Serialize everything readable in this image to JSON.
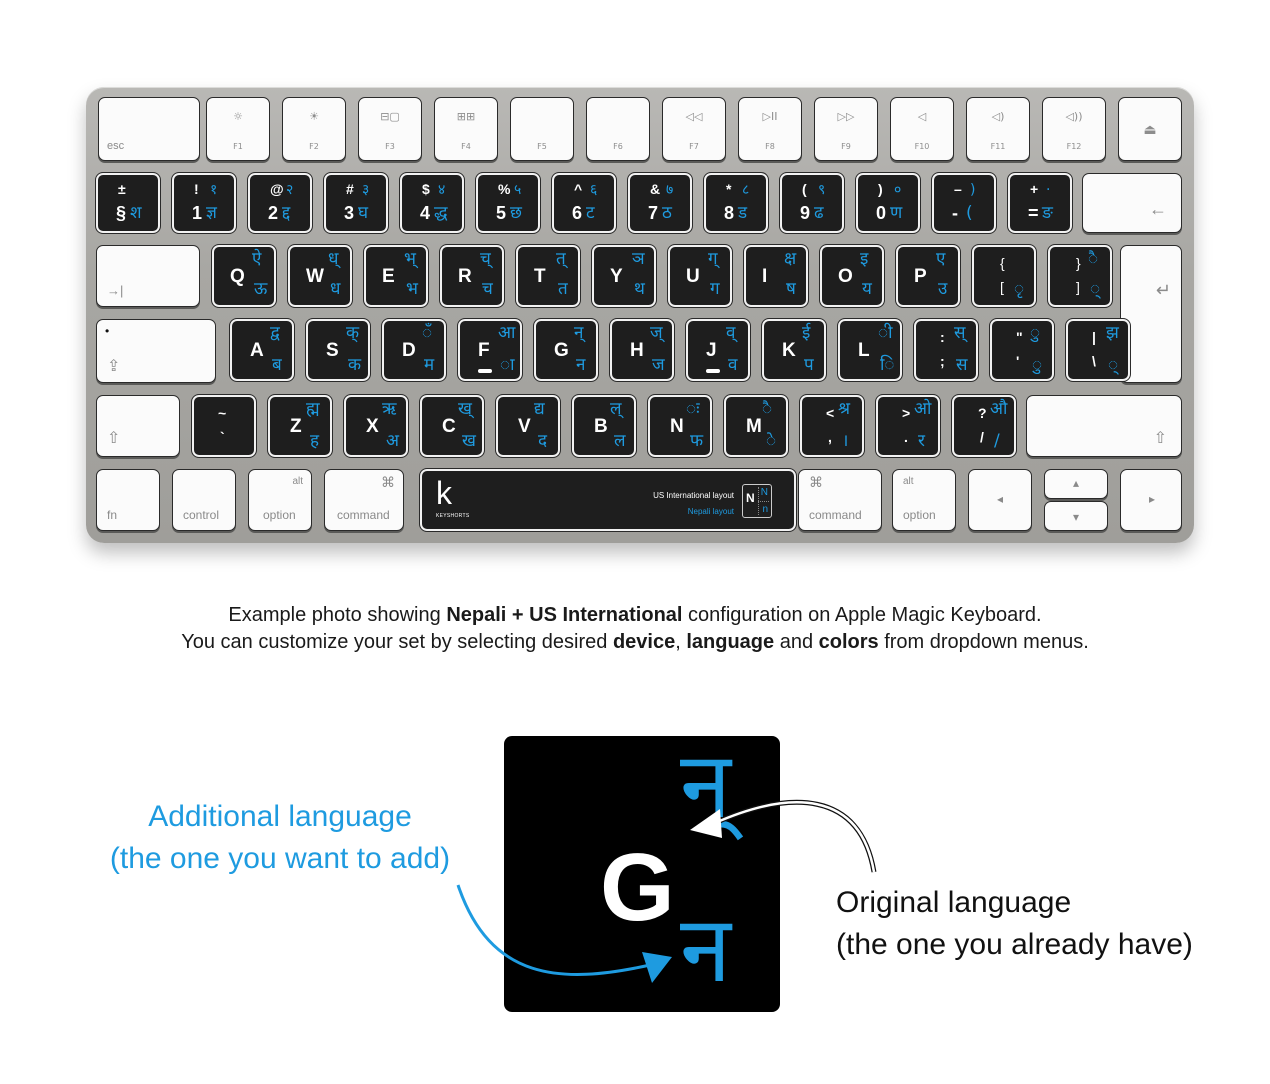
{
  "keyboard": {
    "model": "Apple Magic Keyboard",
    "accent_color": "#1e9be0",
    "sticker_color": "#1e1e1e",
    "function_row": [
      {
        "label": "esc",
        "icon": ""
      },
      {
        "label": "F1",
        "icon": "brightness-down-icon",
        "glyph": "☼"
      },
      {
        "label": "F2",
        "icon": "brightness-up-icon",
        "glyph": "☀"
      },
      {
        "label": "F3",
        "icon": "mission-control-icon",
        "glyph": "⊟▢"
      },
      {
        "label": "F4",
        "icon": "launchpad-icon",
        "glyph": "⊞⊞"
      },
      {
        "label": "F5",
        "icon": ""
      },
      {
        "label": "F6",
        "icon": ""
      },
      {
        "label": "F7",
        "icon": "rewind-icon",
        "glyph": "◁◁"
      },
      {
        "label": "F8",
        "icon": "play-pause-icon",
        "glyph": "▷II"
      },
      {
        "label": "F9",
        "icon": "fast-forward-icon",
        "glyph": "▷▷"
      },
      {
        "label": "F10",
        "icon": "mute-icon",
        "glyph": "◁"
      },
      {
        "label": "F11",
        "icon": "volume-down-icon",
        "glyph": "◁)"
      },
      {
        "label": "F12",
        "icon": "volume-up-icon",
        "glyph": "◁))"
      },
      {
        "label": "",
        "icon": "eject-icon",
        "glyph": "⏏"
      }
    ],
    "number_row": [
      {
        "shift": "±",
        "base": "§",
        "dev_shift": "",
        "dev_base": "श"
      },
      {
        "shift": "!",
        "base": "1",
        "dev_shift": "१",
        "dev_base": "ज्ञ"
      },
      {
        "shift": "@",
        "base": "2",
        "dev_shift": "२",
        "dev_base": "द्द"
      },
      {
        "shift": "#",
        "base": "3",
        "dev_shift": "३",
        "dev_base": "घ"
      },
      {
        "shift": "$",
        "base": "4",
        "dev_shift": "४",
        "dev_base": "द्ध"
      },
      {
        "shift": "%",
        "base": "5",
        "dev_shift": "५",
        "dev_base": "छ"
      },
      {
        "shift": "^",
        "base": "6",
        "dev_shift": "६",
        "dev_base": "ट"
      },
      {
        "shift": "&",
        "base": "7",
        "dev_shift": "७",
        "dev_base": "ठ"
      },
      {
        "shift": "*",
        "base": "8",
        "dev_shift": "८",
        "dev_base": "ड"
      },
      {
        "shift": "(",
        "base": "9",
        "dev_shift": "९",
        "dev_base": "ढ"
      },
      {
        "shift": ")",
        "base": "0",
        "dev_shift": "०",
        "dev_base": "ण"
      },
      {
        "shift": "–",
        "base": "-",
        "dev_shift": ")",
        "dev_base": "("
      },
      {
        "shift": "+",
        "base": "=",
        "dev_shift": "·",
        "dev_base": "ङ"
      }
    ],
    "backspace_glyph": "←",
    "tab_glyph": "→|",
    "qwerty_row": [
      {
        "latin": "Q",
        "dev_shift": "ऐ",
        "dev_base": "ऊ"
      },
      {
        "latin": "W",
        "dev_shift": "ध्",
        "dev_base": "ध"
      },
      {
        "latin": "E",
        "dev_shift": "भ्",
        "dev_base": "भ"
      },
      {
        "latin": "R",
        "dev_shift": "च्",
        "dev_base": "च"
      },
      {
        "latin": "T",
        "dev_shift": "त्",
        "dev_base": "त"
      },
      {
        "latin": "Y",
        "dev_shift": "ञ",
        "dev_base": "थ"
      },
      {
        "latin": "U",
        "dev_shift": "ग्",
        "dev_base": "ग"
      },
      {
        "latin": "I",
        "dev_shift": "क्ष",
        "dev_base": "ष"
      },
      {
        "latin": "O",
        "dev_shift": "इ",
        "dev_base": "य"
      },
      {
        "latin": "P",
        "dev_shift": "ए",
        "dev_base": "उ"
      },
      {
        "latin": "{ [",
        "dev_shift": "",
        "dev_base": "ृ"
      },
      {
        "latin": "} ]",
        "dev_shift": "ै",
        "dev_base": "्"
      }
    ],
    "return_glyph": "↵",
    "home_row": [
      {
        "latin": "A",
        "dev_shift": "द्व",
        "dev_base": "ब"
      },
      {
        "latin": "S",
        "dev_shift": "क्",
        "dev_base": "क"
      },
      {
        "latin": "D",
        "dev_shift": "ँ",
        "dev_base": "म"
      },
      {
        "latin": "F",
        "dev_shift": "आ",
        "dev_base": "ा"
      },
      {
        "latin": "G",
        "dev_shift": "न्",
        "dev_base": "न"
      },
      {
        "latin": "H",
        "dev_shift": "ज्",
        "dev_base": "ज"
      },
      {
        "latin": "J",
        "dev_shift": "व्",
        "dev_base": "व"
      },
      {
        "latin": "K",
        "dev_shift": "ई",
        "dev_base": "प"
      },
      {
        "latin": "L",
        "dev_shift": "ी",
        "dev_base": "ि"
      },
      {
        "latin": ": ;",
        "dev_shift": "स्",
        "dev_base": "स"
      },
      {
        "latin": "\" '",
        "dev_shift": "ु",
        "dev_base": "ु"
      },
      {
        "latin": "| \\",
        "dev_shift": "झ",
        "dev_base": "्"
      }
    ],
    "caps_glyph": "⇪",
    "shift_glyph": "⇧",
    "bottom_row": [
      {
        "latin": "~ `",
        "dev_shift": "",
        "dev_base": ""
      },
      {
        "latin": "Z",
        "dev_shift": "ह्म",
        "dev_base": "ह"
      },
      {
        "latin": "X",
        "dev_shift": "ऋ",
        "dev_base": "अ"
      },
      {
        "latin": "C",
        "dev_shift": "ख्",
        "dev_base": "ख"
      },
      {
        "latin": "V",
        "dev_shift": "द्य",
        "dev_base": "द"
      },
      {
        "latin": "B",
        "dev_shift": "ल्",
        "dev_base": "ल"
      },
      {
        "latin": "N",
        "dev_shift": "ः",
        "dev_base": "फ"
      },
      {
        "latin": "M",
        "dev_shift": "ै",
        "dev_base": "े"
      },
      {
        "latin": "< ,",
        "dev_shift": "श्र",
        "dev_base": "।"
      },
      {
        "latin": "> .",
        "dev_shift": "ओ",
        "dev_base": "र"
      },
      {
        "latin": "? /",
        "dev_shift": "औ",
        "dev_base": "/"
      }
    ],
    "modifier_row": {
      "fn": "fn",
      "control": "control",
      "option_left": {
        "top": "alt",
        "bottom": "option"
      },
      "command_left": {
        "top": "⌘",
        "bottom": "command"
      },
      "command_right": {
        "top": "⌘",
        "bottom": "command"
      },
      "option_right": {
        "top": "alt",
        "bottom": "option"
      },
      "arrow_left": "◂",
      "arrow_up": "▴",
      "arrow_down": "▾",
      "arrow_right": "▸"
    },
    "spacebar": {
      "brand_letter": "k",
      "brand_name": "KEYSHORTS",
      "legend_primary": "US International layout",
      "legend_secondary": "Nepali layout",
      "legend_box": {
        "big": "N",
        "upper": "N",
        "lower": "n"
      }
    }
  },
  "caption": {
    "line1": [
      {
        "t": "Example photo showing ",
        "b": false
      },
      {
        "t": "Nepali + US International",
        "b": true
      },
      {
        "t": " configuration on Apple Magic Keyboard.",
        "b": false
      }
    ],
    "line2": [
      {
        "t": "You can customize your set by selecting desired ",
        "b": false
      },
      {
        "t": "device",
        "b": true
      },
      {
        "t": ", ",
        "b": false
      },
      {
        "t": "language",
        "b": true
      },
      {
        "t": " and ",
        "b": false
      },
      {
        "t": "colors",
        "b": true
      },
      {
        "t": " from dropdown menus.",
        "b": false
      }
    ]
  },
  "explainer": {
    "additional_title": "Additional language",
    "additional_sub": "(the one you want to add)",
    "original_title": "Original language",
    "original_sub": "(the one you already have)",
    "sample_latin": "G",
    "sample_dev_shift": "न्",
    "sample_dev_base": "न"
  }
}
